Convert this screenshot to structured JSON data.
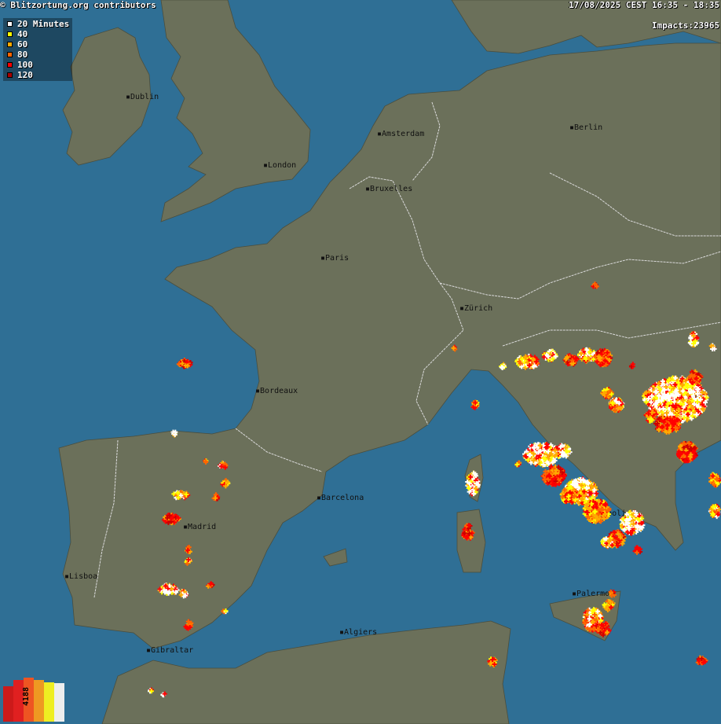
{
  "credit": "© Blitzortung.org contributors",
  "time_range": "17/08/2025 CEST 16:35 - 18:35",
  "impacts": "Impacts:23965",
  "legend": [
    {
      "label": "20 Minutes",
      "color": "#ffffff"
    },
    {
      "label": "40",
      "color": "#ffff00"
    },
    {
      "label": "60",
      "color": "#ffaa00"
    },
    {
      "label": "80",
      "color": "#ff6600"
    },
    {
      "label": "100",
      "color": "#ff0000"
    },
    {
      "label": "120",
      "color": "#aa0000"
    }
  ],
  "histogram": {
    "count": "4188",
    "bar_colors": [
      "#cc1a1a",
      "#e02020",
      "#ee5522",
      "#ee9922",
      "#eeee22",
      "#eeeeee"
    ],
    "bar_levels": [
      0.8,
      0.95,
      1.0,
      0.95,
      0.9,
      0.88
    ]
  },
  "cities": [
    {
      "name": "Dublin"
    },
    {
      "name": "London"
    },
    {
      "name": "Amsterdam"
    },
    {
      "name": "Berlin"
    },
    {
      "name": "Bruxelles"
    },
    {
      "name": "Paris"
    },
    {
      "name": "Zürich"
    },
    {
      "name": "Bordeaux"
    },
    {
      "name": "Barcelona"
    },
    {
      "name": "Madrid"
    },
    {
      "name": "Lisboa"
    },
    {
      "name": "Gibraltar"
    },
    {
      "name": "Algiers"
    },
    {
      "name": "Napoli"
    },
    {
      "name": "Palermo"
    }
  ],
  "colors": {
    "sea": "#2f6f95",
    "land": "#6b705a",
    "border": "#d9d9d9"
  }
}
